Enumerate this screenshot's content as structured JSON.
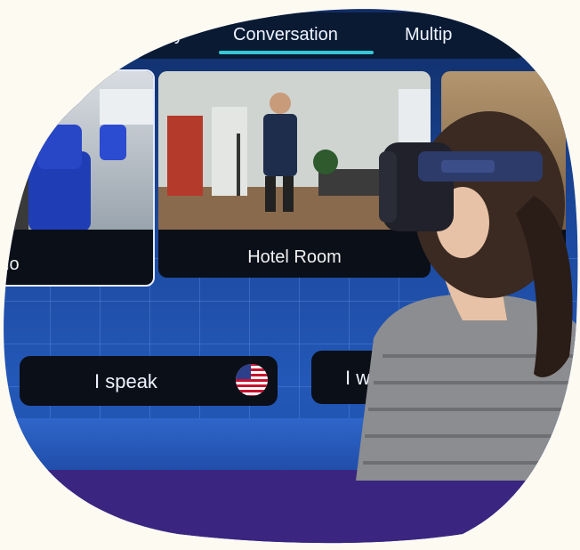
{
  "tabs": [
    {
      "label": "y"
    },
    {
      "label": "Conversation",
      "active": true
    },
    {
      "label": "Multip"
    }
  ],
  "cards": [
    {
      "label": "lo"
    },
    {
      "label": "Hotel Room"
    },
    {
      "label": ""
    }
  ],
  "buttons": {
    "speak_label": "I speak",
    "want_label": "I wa",
    "flag": "us-flag-icon"
  },
  "colors": {
    "background": "#fdfaf2",
    "scene_blue": "#1d4aa0",
    "accent_teal": "#35c7d6",
    "bottom_band": "#3a2580",
    "panel_dark": "#0b0f18"
  }
}
